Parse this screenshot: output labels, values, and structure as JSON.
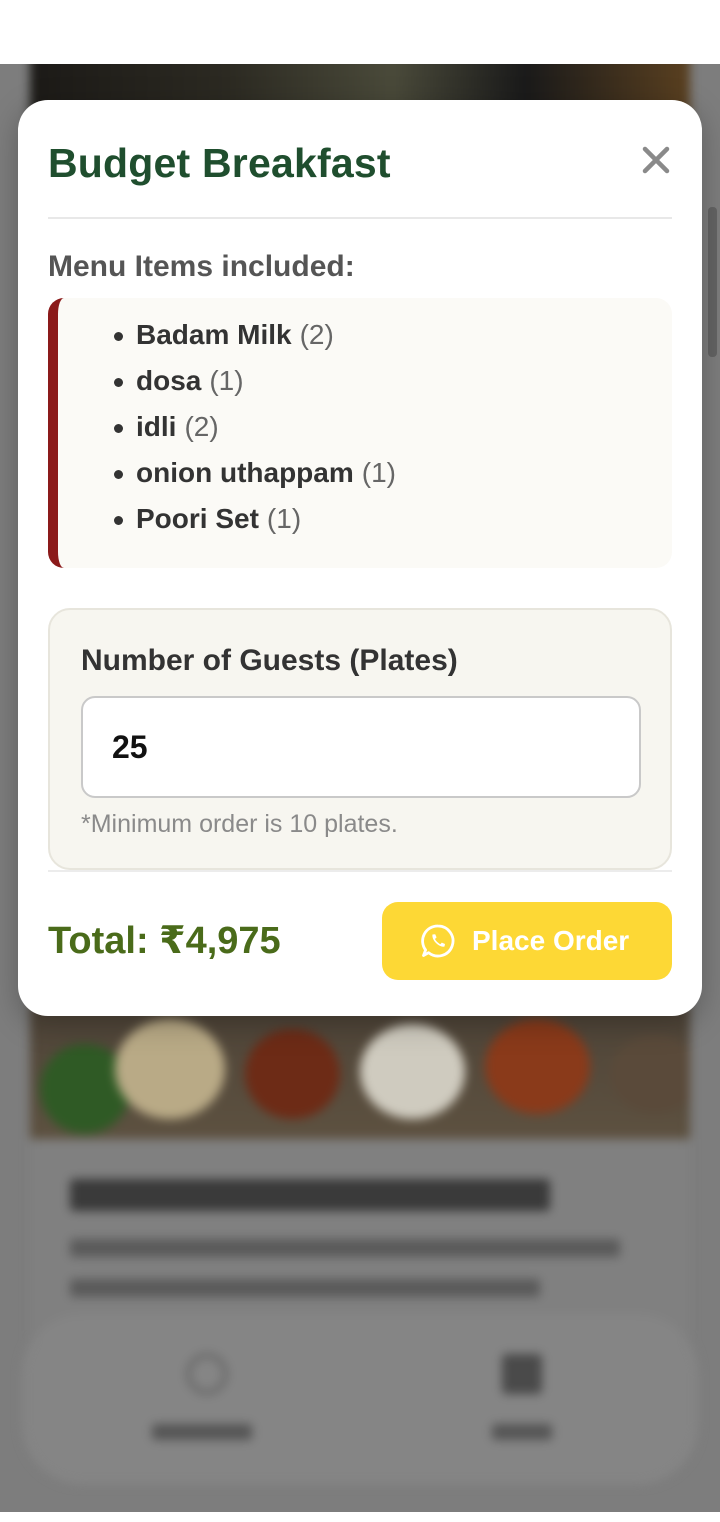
{
  "modal": {
    "title": "Budget Breakfast",
    "close_icon": "close-icon",
    "menu_heading": "Menu Items included:",
    "menu_items": [
      {
        "name": "Badam Milk",
        "qty": "(2)"
      },
      {
        "name": "dosa",
        "qty": "(1)"
      },
      {
        "name": "idli",
        "qty": "(2)"
      },
      {
        "name": "onion uthappam",
        "qty": "(1)"
      },
      {
        "name": "Poori Set",
        "qty": "(1)"
      }
    ],
    "guests": {
      "label": "Number of Guests (Plates)",
      "value": "25",
      "note": "*Minimum order is 10 plates."
    },
    "total": "Total: ₹4,975",
    "order_button": {
      "label": "Place Order",
      "icon": "whatsapp-icon"
    }
  },
  "colors": {
    "title": "#1f4e2e",
    "accent_border": "#8b1a1a",
    "total": "#4a6b1a",
    "button": "#fdd835"
  }
}
